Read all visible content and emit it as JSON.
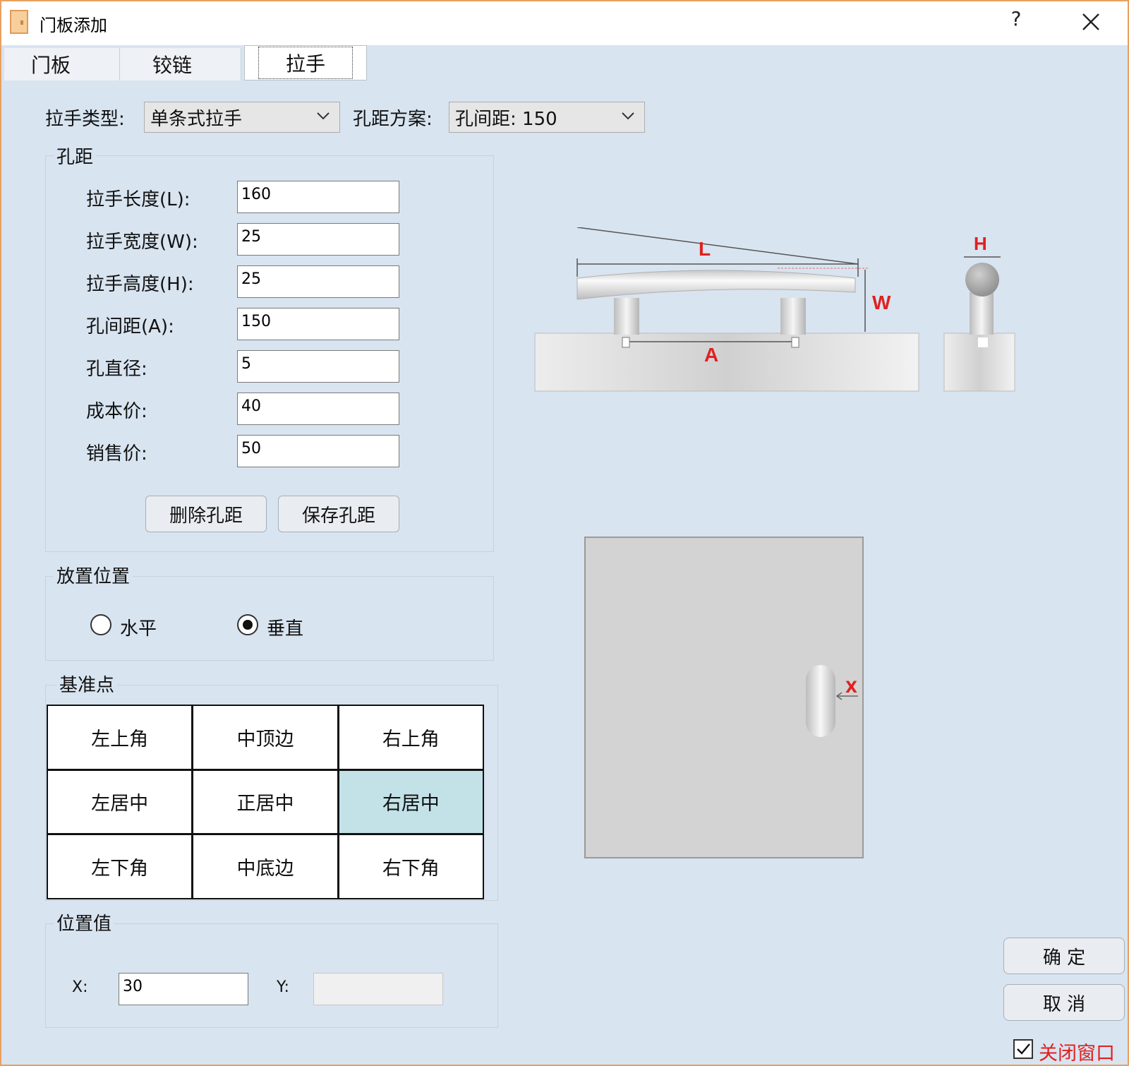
{
  "window": {
    "title": "门板添加",
    "help": "?",
    "close": "✕"
  },
  "tabs": [
    {
      "label": "门板"
    },
    {
      "label": "铰链"
    },
    {
      "label": "拉手",
      "active": true
    }
  ],
  "handle_type": {
    "label": "拉手类型:",
    "value": "单条式拉手"
  },
  "hole_scheme": {
    "label": "孔距方案:",
    "value": "孔间距: 150"
  },
  "hole_group": {
    "title": "孔距",
    "fields": [
      {
        "label": "拉手长度(L):",
        "value": "160"
      },
      {
        "label": "拉手宽度(W):",
        "value": "25"
      },
      {
        "label": "拉手高度(H):",
        "value": "25"
      },
      {
        "label": "孔间距(A):",
        "value": "150"
      },
      {
        "label": "孔直径:",
        "value": "5"
      },
      {
        "label": "成本价:",
        "value": "40"
      },
      {
        "label": "销售价:",
        "value": "50"
      }
    ],
    "delete_button": "删除孔距",
    "save_button": "保存孔距"
  },
  "placement": {
    "title": "放置位置",
    "horizontal": "水平",
    "vertical": "垂直",
    "selected": "vertical"
  },
  "reference": {
    "title": "基准点",
    "cells": [
      "左上角",
      "中顶边",
      "右上角",
      "左居中",
      "正居中",
      "右居中",
      "左下角",
      "中底边",
      "右下角"
    ],
    "selected": "右居中"
  },
  "position": {
    "title": "位置值",
    "x_label": "X:",
    "x_value": "30",
    "y_label": "Y:",
    "y_value": ""
  },
  "diagram": {
    "L": "L",
    "W": "W",
    "A": "A",
    "H": "H",
    "X": "X"
  },
  "actions": {
    "ok": "确 定",
    "cancel": "取 消",
    "close_window": "关闭窗口",
    "close_window_checked": true
  },
  "colors": {
    "background": "#d8e4f0",
    "accent_red": "#e02020",
    "selected_cell": "#c2e2e8"
  }
}
